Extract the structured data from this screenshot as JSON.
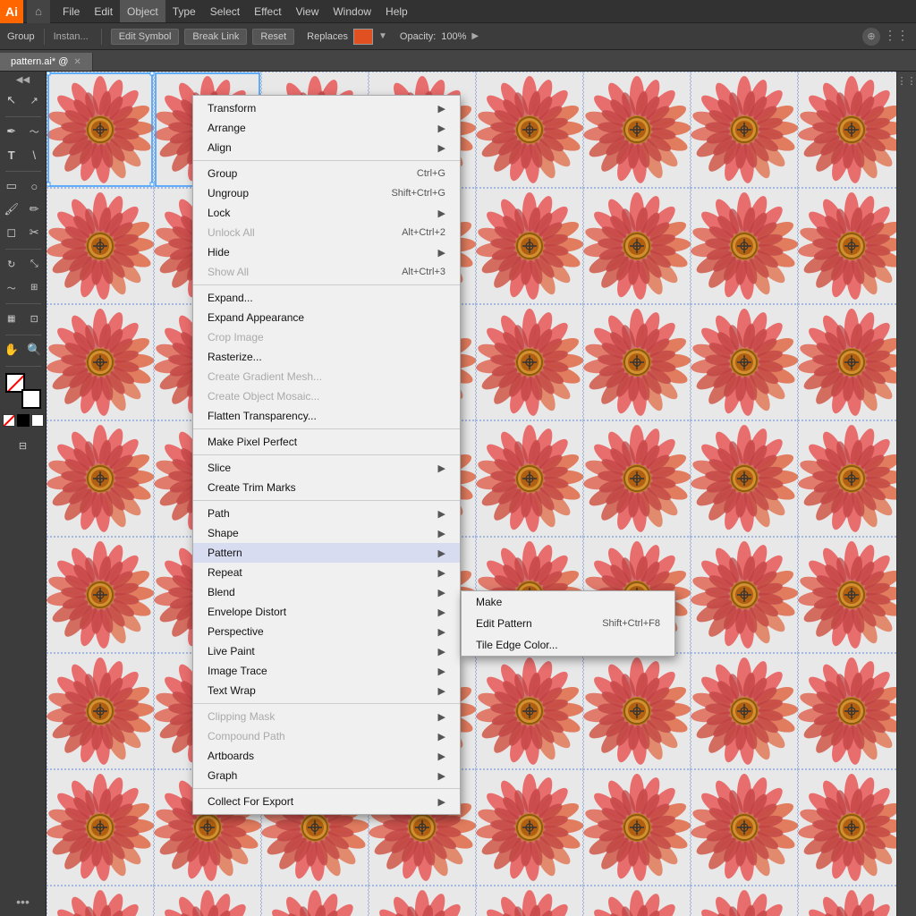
{
  "app": {
    "name": "Ai",
    "version": "Adobe Illustrator"
  },
  "menu_bar": {
    "items": [
      "File",
      "Edit",
      "Object",
      "Type",
      "Select",
      "Effect",
      "View",
      "Window",
      "Help"
    ]
  },
  "active_menu": "Object",
  "options_bar": {
    "group_label": "Group",
    "buttons": [
      "Edit Symbol",
      "Break Link",
      "Reset"
    ],
    "replaces_label": "Replaces",
    "opacity_label": "Opacity:",
    "opacity_value": "100%"
  },
  "tab": {
    "name": "pattern.ai*",
    "symbol": "@"
  },
  "object_menu": {
    "sections": [
      {
        "items": [
          {
            "label": "Transform",
            "shortcut": "",
            "arrow": true,
            "disabled": false
          },
          {
            "label": "Arrange",
            "shortcut": "",
            "arrow": true,
            "disabled": false
          },
          {
            "label": "Align",
            "shortcut": "",
            "arrow": true,
            "disabled": false
          }
        ]
      },
      {
        "items": [
          {
            "label": "Group",
            "shortcut": "Ctrl+G",
            "arrow": false,
            "disabled": false
          },
          {
            "label": "Ungroup",
            "shortcut": "Shift+Ctrl+G",
            "arrow": false,
            "disabled": false
          },
          {
            "label": "Lock",
            "shortcut": "",
            "arrow": true,
            "disabled": false
          },
          {
            "label": "Unlock All",
            "shortcut": "Alt+Ctrl+2",
            "arrow": false,
            "disabled": false
          },
          {
            "label": "Hide",
            "shortcut": "",
            "arrow": true,
            "disabled": false
          },
          {
            "label": "Show All",
            "shortcut": "Alt+Ctrl+3",
            "arrow": false,
            "disabled": false
          }
        ]
      },
      {
        "items": [
          {
            "label": "Expand...",
            "shortcut": "",
            "arrow": false,
            "disabled": false
          },
          {
            "label": "Expand Appearance",
            "shortcut": "",
            "arrow": false,
            "disabled": false
          },
          {
            "label": "Crop Image",
            "shortcut": "",
            "arrow": false,
            "disabled": true
          },
          {
            "label": "Rasterize...",
            "shortcut": "",
            "arrow": false,
            "disabled": false
          },
          {
            "label": "Create Gradient Mesh...",
            "shortcut": "",
            "arrow": false,
            "disabled": true
          },
          {
            "label": "Create Object Mosaic...",
            "shortcut": "",
            "arrow": false,
            "disabled": true
          },
          {
            "label": "Flatten Transparency...",
            "shortcut": "",
            "arrow": false,
            "disabled": false
          }
        ]
      },
      {
        "items": [
          {
            "label": "Make Pixel Perfect",
            "shortcut": "",
            "arrow": false,
            "disabled": false
          }
        ]
      },
      {
        "items": [
          {
            "label": "Slice",
            "shortcut": "",
            "arrow": true,
            "disabled": false
          },
          {
            "label": "Create Trim Marks",
            "shortcut": "",
            "arrow": false,
            "disabled": false
          }
        ]
      },
      {
        "items": [
          {
            "label": "Path",
            "shortcut": "",
            "arrow": true,
            "disabled": false
          },
          {
            "label": "Shape",
            "shortcut": "",
            "arrow": true,
            "disabled": false
          },
          {
            "label": "Pattern",
            "shortcut": "",
            "arrow": true,
            "disabled": false,
            "highlighted": true
          },
          {
            "label": "Repeat",
            "shortcut": "",
            "arrow": true,
            "disabled": false
          },
          {
            "label": "Blend",
            "shortcut": "",
            "arrow": true,
            "disabled": false
          },
          {
            "label": "Envelope Distort",
            "shortcut": "",
            "arrow": true,
            "disabled": false
          },
          {
            "label": "Perspective",
            "shortcut": "",
            "arrow": true,
            "disabled": false
          },
          {
            "label": "Live Paint",
            "shortcut": "",
            "arrow": true,
            "disabled": false
          },
          {
            "label": "Image Trace",
            "shortcut": "",
            "arrow": true,
            "disabled": false
          },
          {
            "label": "Text Wrap",
            "shortcut": "",
            "arrow": true,
            "disabled": false
          }
        ]
      },
      {
        "items": [
          {
            "label": "Clipping Mask",
            "shortcut": "",
            "arrow": true,
            "disabled": true
          },
          {
            "label": "Compound Path",
            "shortcut": "",
            "arrow": true,
            "disabled": true
          },
          {
            "label": "Artboards",
            "shortcut": "",
            "arrow": true,
            "disabled": false
          },
          {
            "label": "Graph",
            "shortcut": "",
            "arrow": true,
            "disabled": false
          }
        ]
      },
      {
        "items": [
          {
            "label": "Collect For Export",
            "shortcut": "",
            "arrow": true,
            "disabled": false
          }
        ]
      }
    ]
  },
  "pattern_submenu": {
    "items": [
      {
        "label": "Make",
        "shortcut": "",
        "disabled": false
      },
      {
        "label": "Edit Pattern",
        "shortcut": "Shift+Ctrl+F8",
        "disabled": false
      },
      {
        "label": "Tile Edge Color...",
        "shortcut": "",
        "disabled": false
      }
    ]
  },
  "submenu_top_offset": "580",
  "colors": {
    "menu_highlight": "#d0d8f8",
    "flower_pink": "#e87070",
    "flower_center": "#c87820"
  }
}
